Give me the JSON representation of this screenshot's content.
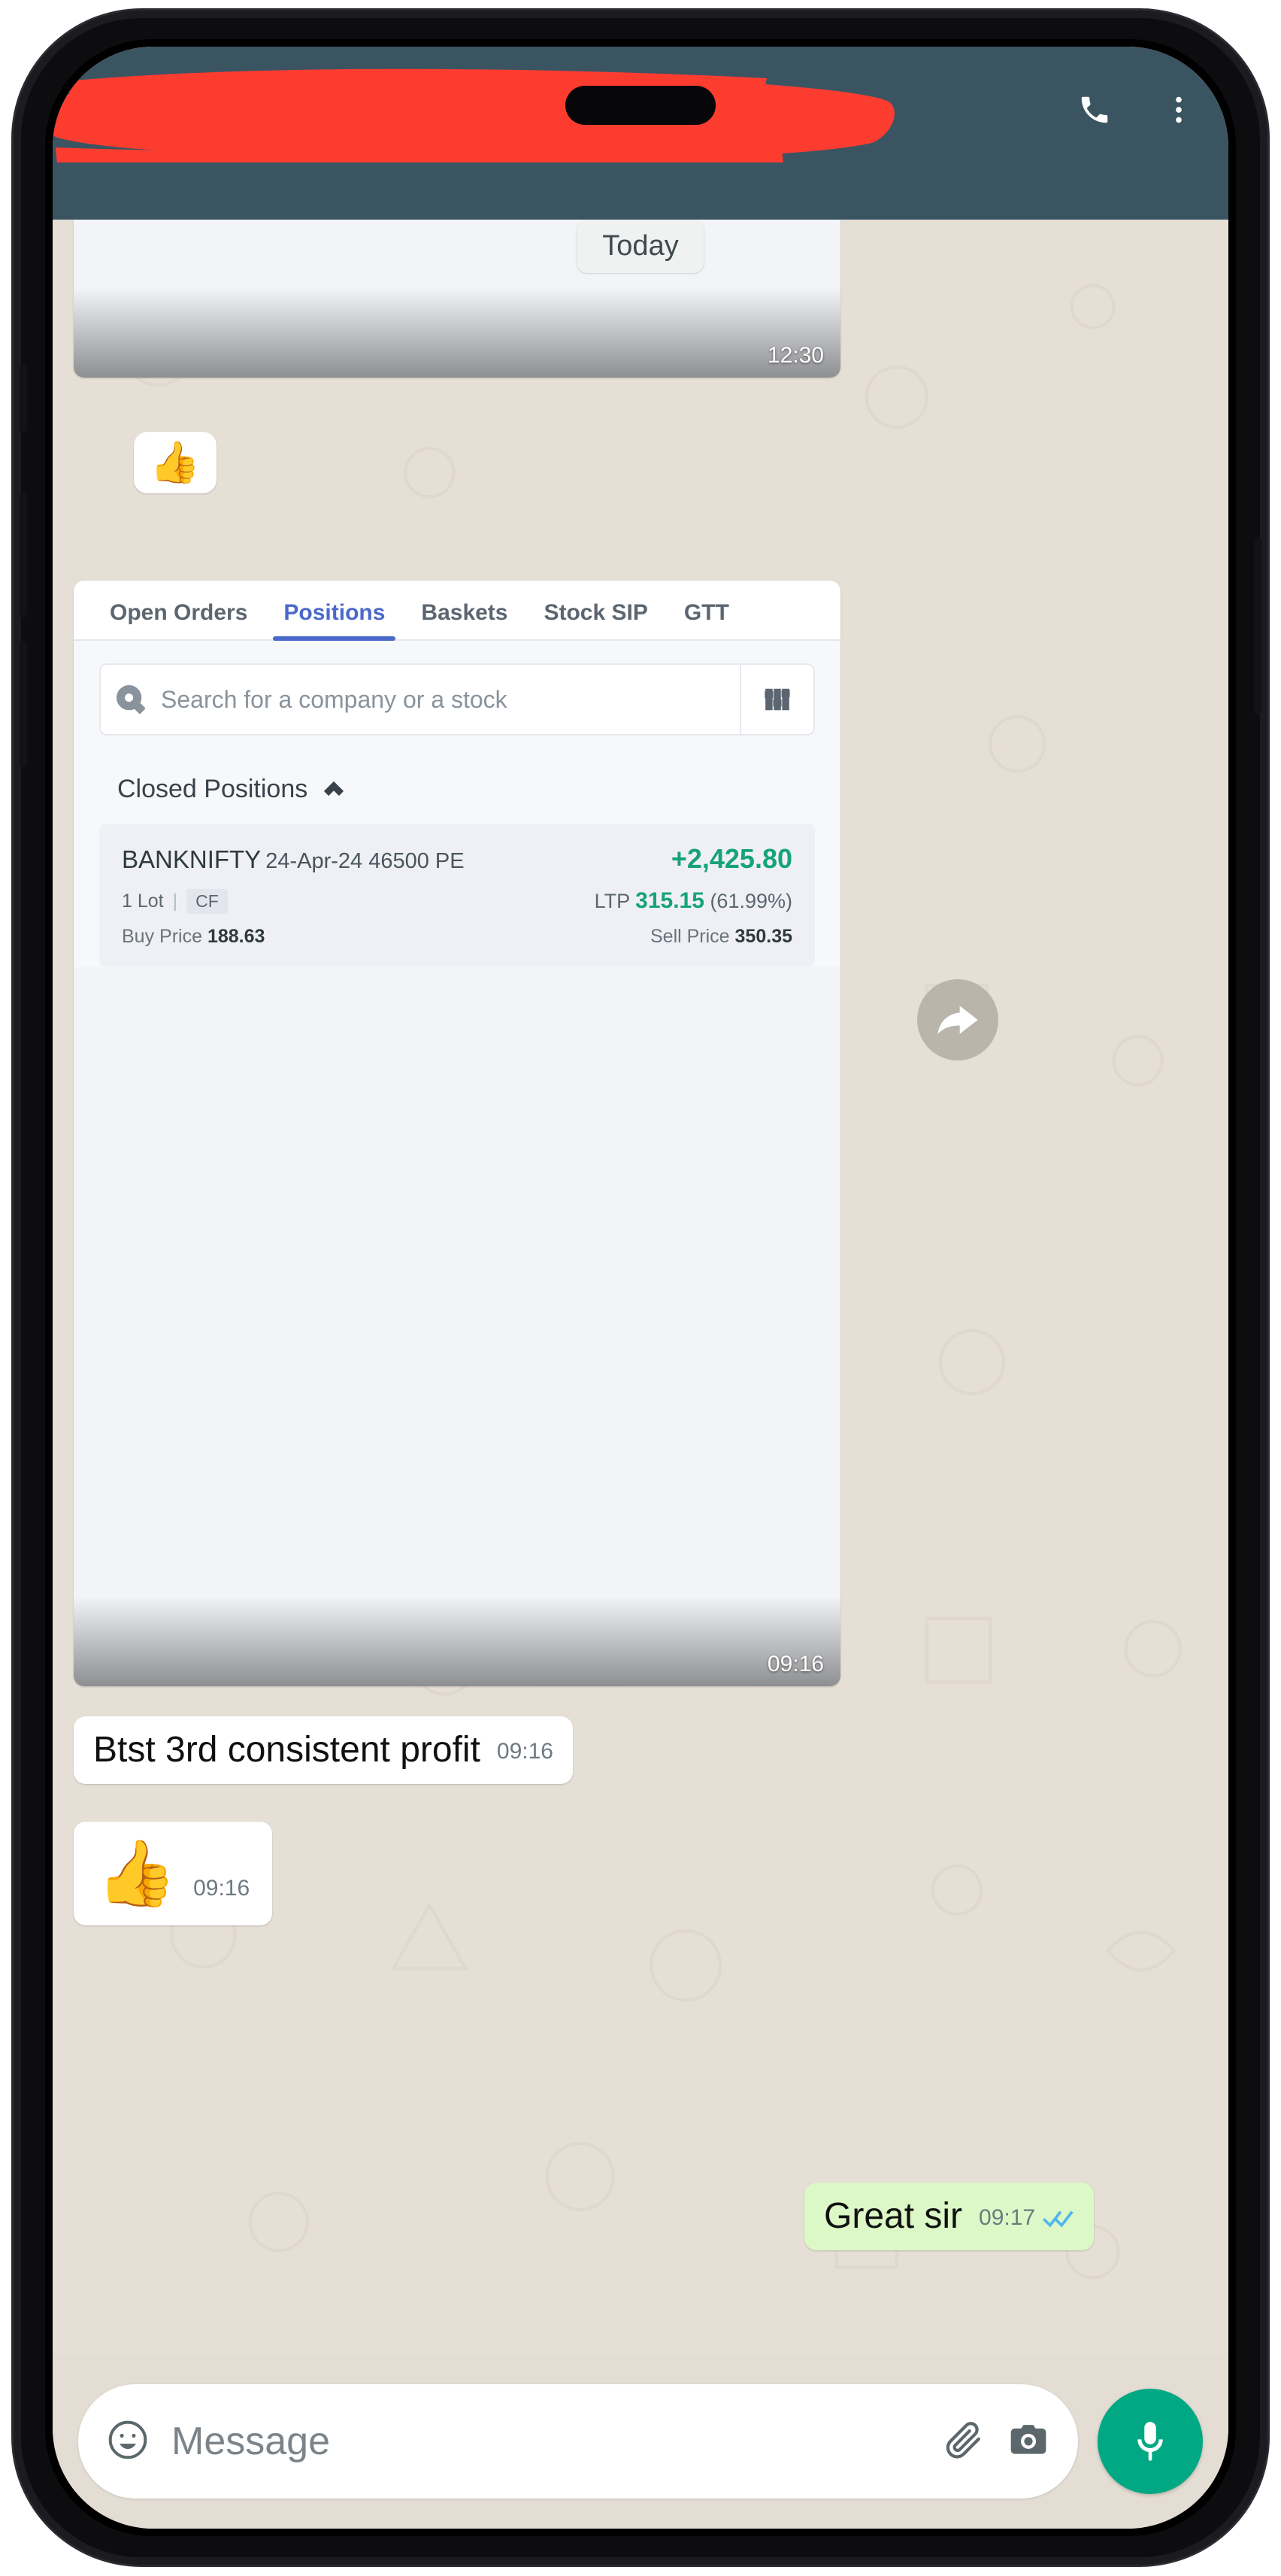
{
  "header": {
    "contact_name_redacted": "",
    "call_icon": "phone-icon",
    "menu_icon": "overflow-menu-icon"
  },
  "chat": {
    "date_divider": "Today",
    "messages": [
      {
        "type": "screenshot",
        "time": "12:30"
      },
      {
        "type": "emoji",
        "emoji": "👍",
        "time": ""
      },
      {
        "type": "screenshot_app",
        "time": "09:16"
      },
      {
        "type": "text",
        "text": "Btst 3rd consistent profit",
        "time": "09:16",
        "direction": "in"
      },
      {
        "type": "emoji",
        "emoji": "👍",
        "time": "09:16",
        "direction": "in"
      },
      {
        "type": "text",
        "text": "Great sir",
        "time": "09:17",
        "direction": "out",
        "status": "read"
      }
    ],
    "forward_icon": "forward-arrow-icon"
  },
  "broker_app": {
    "tabs": [
      {
        "label": "Open Orders",
        "active": false
      },
      {
        "label": "Positions",
        "active": true
      },
      {
        "label": "Baskets",
        "active": false
      },
      {
        "label": "Stock SIP",
        "active": false
      },
      {
        "label": "GTT",
        "active": false
      }
    ],
    "search": {
      "placeholder": "Search for a company or a stock",
      "search_icon": "search-icon",
      "filter_icon": "filter-sliders-icon"
    },
    "section": {
      "title": "Closed Positions",
      "chevron_icon": "chevron-up-icon"
    },
    "position": {
      "symbol": "BANKNIFTY",
      "expiry": "24-Apr-24 46500 PE",
      "pnl": "+2,425.80",
      "lots": "1 Lot",
      "product": "CF",
      "ltp_label": "LTP",
      "ltp_value": "315.15",
      "ltp_change": "(61.99%)",
      "buy_price_label": "Buy Price",
      "buy_price": "188.63",
      "sell_price_label": "Sell Price",
      "sell_price": "350.35"
    }
  },
  "composer": {
    "placeholder": "Message",
    "emoji_icon": "emoji-smiley-icon",
    "attach_icon": "paperclip-icon",
    "camera_icon": "camera-icon",
    "mic_icon": "microphone-icon"
  },
  "colors": {
    "header_bg": "#3b5462",
    "redaction": "#fd3c30",
    "chat_bg": "#e4ddd4",
    "outgoing_bubble": "#dcf8c6",
    "accent_green": "#00a884",
    "profit_green": "#17a37a",
    "tab_active": "#4a69c9"
  }
}
